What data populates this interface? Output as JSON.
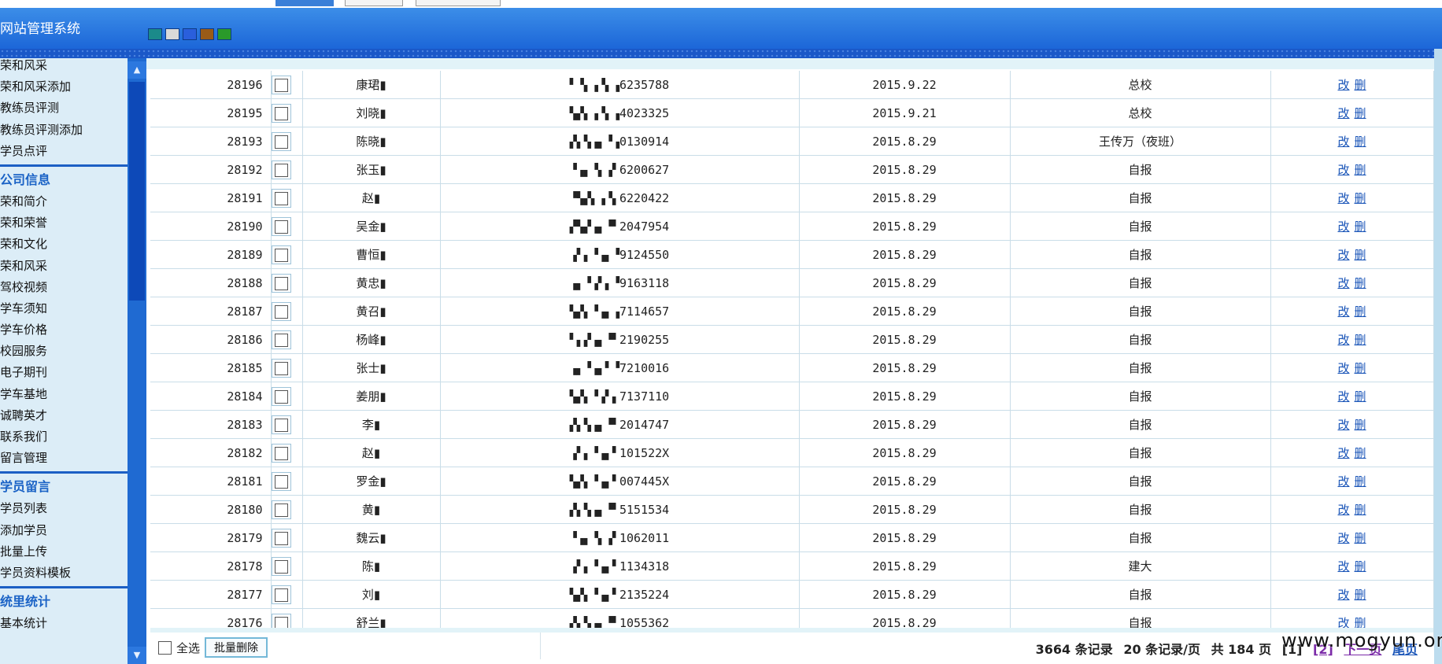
{
  "header": {
    "title": "网站管理系统",
    "swatch_colors": [
      "#1b8a8a",
      "#d9d9d9",
      "#2a5fdc",
      "#9a5b17",
      "#2a9a2a"
    ]
  },
  "sidebar": {
    "group0": [
      "荣和风采",
      "荣和风采添加",
      "教练员评测",
      "教练员评测添加",
      "学员点评"
    ],
    "group1_title": "公司信息",
    "group1": [
      "荣和简介",
      "荣和荣誉",
      "荣和文化",
      "荣和风采",
      "驾校视频",
      "学车须知",
      "学车价格",
      "校园服务",
      "电子期刊",
      "学车基地",
      "诚聘英才",
      "联系我们",
      "留言管理"
    ],
    "group2_title": "学员留言",
    "group2": [
      "学员列表",
      "添加学员",
      "批量上传",
      "学员资料模板"
    ],
    "group3_title": "统里统计",
    "group3": [
      "基本统计"
    ]
  },
  "table": {
    "edit_label": "改",
    "delete_label": "删",
    "rows": [
      {
        "id": "28196",
        "name": "康珺▮",
        "idno": "▘▝▖▗▝▖▗6235788",
        "date": "2015.9.22",
        "school": "总校"
      },
      {
        "id": "28195",
        "name": "刘晓▮",
        "idno": "▚▞▖▗▝▖▗4023325",
        "date": "2015.9.21",
        "school": "总校"
      },
      {
        "id": "28193",
        "name": "陈晓▮",
        "idno": "▞▖▚▗▖▝▗0130914",
        "date": "2015.8.29",
        "school": "王传万（夜班）"
      },
      {
        "id": "28192",
        "name": "张玉▮",
        "idno": "▝▗▖▝▖▗▘6200627",
        "date": "2015.8.29",
        "school": "自报"
      },
      {
        "id": "28191",
        "name": "赵▮",
        "idno": "▝▚▞▖▗▝▖6220422",
        "date": "2015.8.29",
        "school": "自报"
      },
      {
        "id": "28190",
        "name": "吴金▮",
        "idno": "▞▚▞▗▖▝▘2047954",
        "date": "2015.8.29",
        "school": "自报"
      },
      {
        "id": "28189",
        "name": "曹恒▮",
        "idno": "▗▘▖▝▗▖▝9124550",
        "date": "2015.8.29",
        "school": "自报"
      },
      {
        "id": "28188",
        "name": "黄忠▮",
        "idno": "▗▖▝▗▘▖▝9163118",
        "date": "2015.8.29",
        "school": "自报"
      },
      {
        "id": "28187",
        "name": "黄召▮",
        "idno": "▚▞▖▝▗▖▗7114657",
        "date": "2015.8.29",
        "school": "自报"
      },
      {
        "id": "28186",
        "name": "杨峰▮",
        "idno": "▘▖▞▗▖▝▘2190255",
        "date": "2015.8.29",
        "school": "自报"
      },
      {
        "id": "28185",
        "name": "张士▮",
        "idno": "▗▖▝▗▖▘▝7210016",
        "date": "2015.8.29",
        "school": "自报"
      },
      {
        "id": "28184",
        "name": "姜朋▮",
        "idno": "▚▞▖▝▗▘▖7137110",
        "date": "2015.8.29",
        "school": "自报"
      },
      {
        "id": "28183",
        "name": "李▮",
        "idno": "▞▖▚▗▖▝▘2014747",
        "date": "2015.8.29",
        "school": "自报"
      },
      {
        "id": "28182",
        "name": "赵▮",
        "idno": "▗▘▖▝▗▖▘101522X",
        "date": "2015.8.29",
        "school": "自报"
      },
      {
        "id": "28181",
        "name": "罗金▮",
        "idno": "▚▞▖▝▗▖▘007445X",
        "date": "2015.8.29",
        "school": "自报"
      },
      {
        "id": "28180",
        "name": "黄▮",
        "idno": "▞▖▚▗▖▝▘5151534",
        "date": "2015.8.29",
        "school": "自报"
      },
      {
        "id": "28179",
        "name": "魏云▮",
        "idno": "▝▗▖▝▖▗▘1062011",
        "date": "2015.8.29",
        "school": "自报"
      },
      {
        "id": "28178",
        "name": "陈▮",
        "idno": "▗▘▖▝▗▖▘1134318",
        "date": "2015.8.29",
        "school": "建大"
      },
      {
        "id": "28177",
        "name": "刘▮",
        "idno": "▚▞▖▝▗▖▘2135224",
        "date": "2015.8.29",
        "school": "自报"
      },
      {
        "id": "28176",
        "name": "舒兰▮",
        "idno": "▞▖▚▗▖▝▘1055362",
        "date": "2015.8.29",
        "school": "自报"
      }
    ]
  },
  "footer": {
    "select_all": "全选",
    "batch_delete": "批量删除",
    "records": "3664 条记录",
    "per_page": "20 条记录/页",
    "pages": "共 184 页",
    "page1": "[1]",
    "page2": "[2]",
    "next": "下一页",
    "last": "尾页"
  },
  "watermark": "www.mogyun.org"
}
